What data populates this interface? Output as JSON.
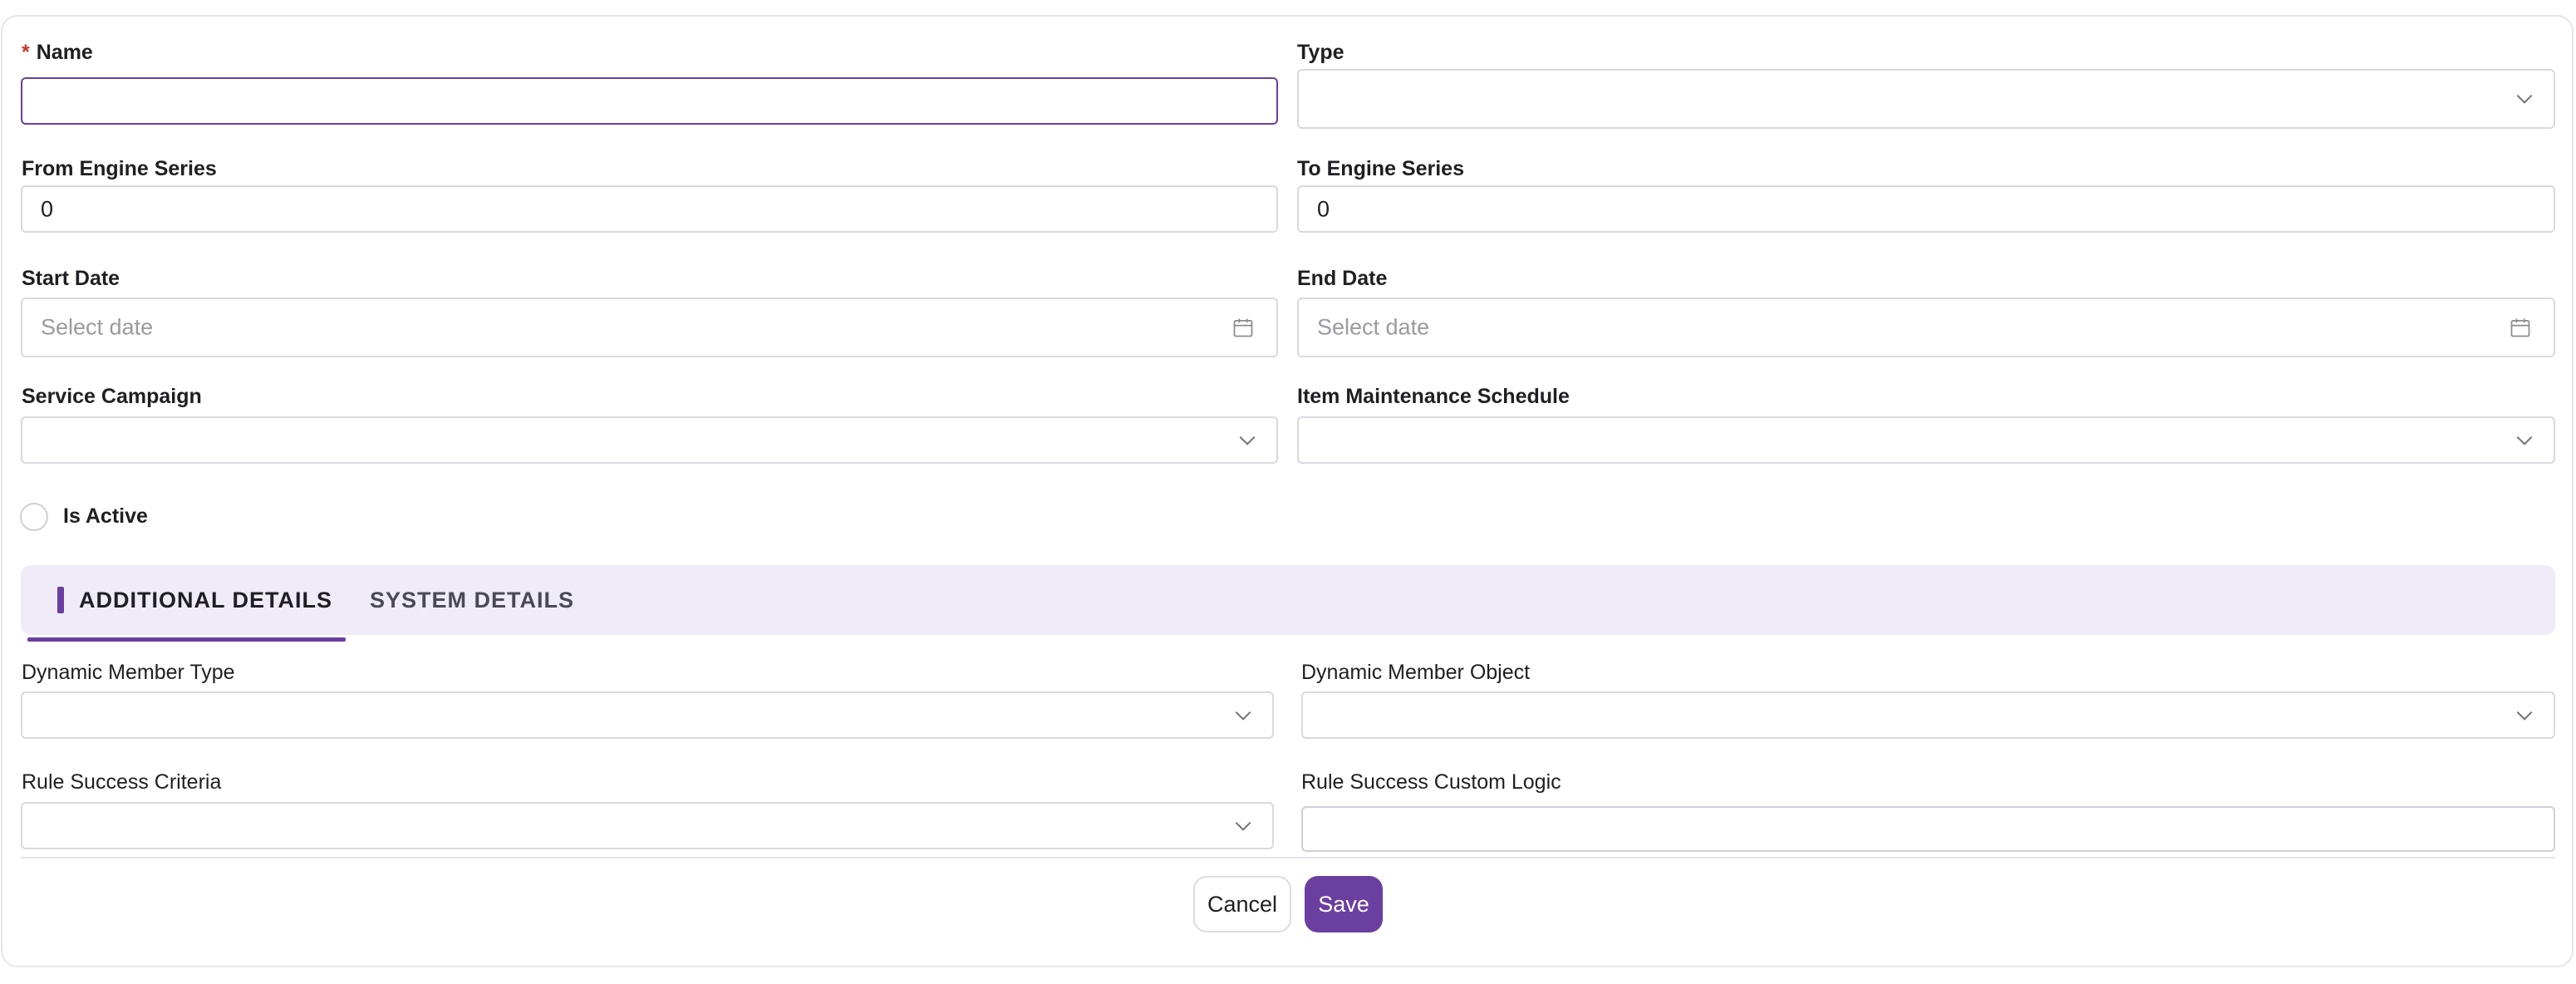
{
  "form": {
    "name": {
      "label": "Name",
      "required_mark": "*",
      "value": ""
    },
    "type": {
      "label": "Type",
      "value": ""
    },
    "from_engine_series": {
      "label": "From Engine Series",
      "value": "0"
    },
    "to_engine_series": {
      "label": "To Engine Series",
      "value": "0"
    },
    "start_date": {
      "label": "Start Date",
      "placeholder": "Select date"
    },
    "end_date": {
      "label": "End Date",
      "placeholder": "Select date"
    },
    "service_campaign": {
      "label": "Service Campaign",
      "value": ""
    },
    "item_maintenance_schedule": {
      "label": "Item Maintenance Schedule",
      "value": ""
    },
    "is_active": {
      "label": "Is Active",
      "checked": false
    }
  },
  "tabs": [
    {
      "label": "ADDITIONAL DETAILS",
      "active": true
    },
    {
      "label": "SYSTEM DETAILS",
      "active": false
    }
  ],
  "additional": {
    "dynamic_member_type": {
      "label": "Dynamic Member Type",
      "value": ""
    },
    "dynamic_member_object": {
      "label": "Dynamic Member Object",
      "value": ""
    },
    "rule_success_criteria": {
      "label": "Rule Success Criteria",
      "value": ""
    },
    "rule_success_custom_logic": {
      "label": "Rule Success Custom Logic",
      "value": ""
    }
  },
  "actions": {
    "cancel_label": "Cancel",
    "save_label": "Save"
  },
  "colors": {
    "accent": "#6b3fa0",
    "tab_bar_bg": "#efecf7",
    "required": "#c0392b",
    "border": "#d9d9de",
    "placeholder": "#9a9aa3"
  },
  "icons": {
    "select": "chevron-down-icon",
    "date": "calendar-icon"
  }
}
